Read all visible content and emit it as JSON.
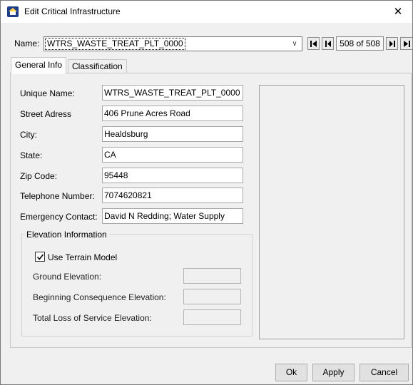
{
  "window": {
    "title": "Edit Critical Infrastructure",
    "close_glyph": "✕",
    "icon": "app-house-icon"
  },
  "toolbar": {
    "name_label": "Name:",
    "name_value": "WTRS_WASTE_TREAT_PLT_0000",
    "dropdown_glyph": "∨",
    "record_counter": "508 of 508"
  },
  "tabs": [
    "General Info",
    "Classification"
  ],
  "general": {
    "fields": [
      {
        "label": "Unique Name:",
        "value": "WTRS_WASTE_TREAT_PLT_0000"
      },
      {
        "label": "Street Adress",
        "value": "406 Prune Acres Road"
      },
      {
        "label": "City:",
        "value": "Healdsburg"
      },
      {
        "label": "State:",
        "value": "CA"
      },
      {
        "label": "Zip Code:",
        "value": "95448"
      },
      {
        "label": "Telephone Number:",
        "value": "7074620821"
      },
      {
        "label": "Emergency Contact:",
        "value": "David N Redding; Water Supply"
      }
    ]
  },
  "elevation": {
    "legend": "Elevation Information",
    "use_terrain_label": "Use Terrain Model",
    "use_terrain_checked": true,
    "ground_label": "Ground Elevation:",
    "ground_value": "",
    "beginning_label": "Beginning Consequence Elevation:",
    "beginning_value": "",
    "total_loss_label": "Total Loss of Service Elevation:",
    "total_loss_value": ""
  },
  "buttons": {
    "ok": "Ok",
    "apply": "Apply",
    "cancel": "Cancel"
  }
}
